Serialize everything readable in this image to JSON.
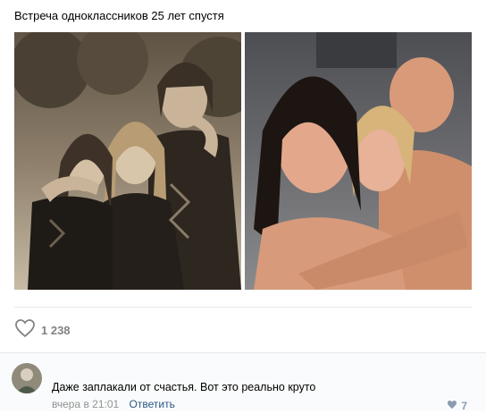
{
  "post": {
    "text": "Встреча одноклассников 25 лет спустя",
    "likes": "1 238"
  },
  "photos": [
    {
      "name": "left-photo",
      "tone": "sepia"
    },
    {
      "name": "right-photo",
      "tone": "color"
    }
  ],
  "comment": {
    "text": "Даже заплакали от счастья. Вот это реально круто",
    "time": "вчера в 21:01",
    "reply_label": "Ответить",
    "likes": "7"
  },
  "colors": {
    "link": "#2a5885",
    "muted": "#939393",
    "like_icon": "#828282"
  },
  "icons": [
    "heart-outline-icon",
    "heart-small-icon"
  ]
}
